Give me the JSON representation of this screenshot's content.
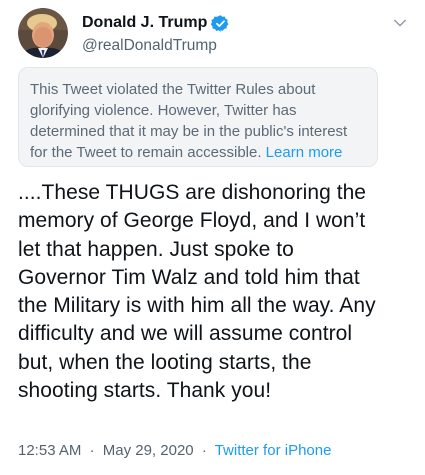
{
  "tweet": {
    "author": {
      "display_name": "Donald J. Trump",
      "handle": "@realDonaldTrump",
      "verified": true,
      "avatar_icon": "profile-photo"
    },
    "notice": {
      "text": "This Tweet violated the Twitter Rules about glorifying violence. However, Twitter has determined that it may be in the public's interest for the Tweet to remain accessible.",
      "link_label": "Learn more"
    },
    "body_lines": [
      "....These THUGS are dishonoring the",
      "memory of George Floyd, and I won’t",
      "let that happen. Just spoke to",
      "Governor Tim Walz and told him that",
      "the Military is with him all the way. Any",
      "difficulty and we will assume control",
      "but, when the looting starts, the",
      "shooting starts. Thank you!"
    ],
    "meta": {
      "time": "12:53 AM",
      "separator": "·",
      "date": "May 29, 2020",
      "source": "Twitter for iPhone"
    },
    "colors": {
      "accent": "#1d9bf0",
      "text": "#0f1419",
      "secondary": "#536471",
      "notice_background": "#f3f4f6"
    }
  }
}
